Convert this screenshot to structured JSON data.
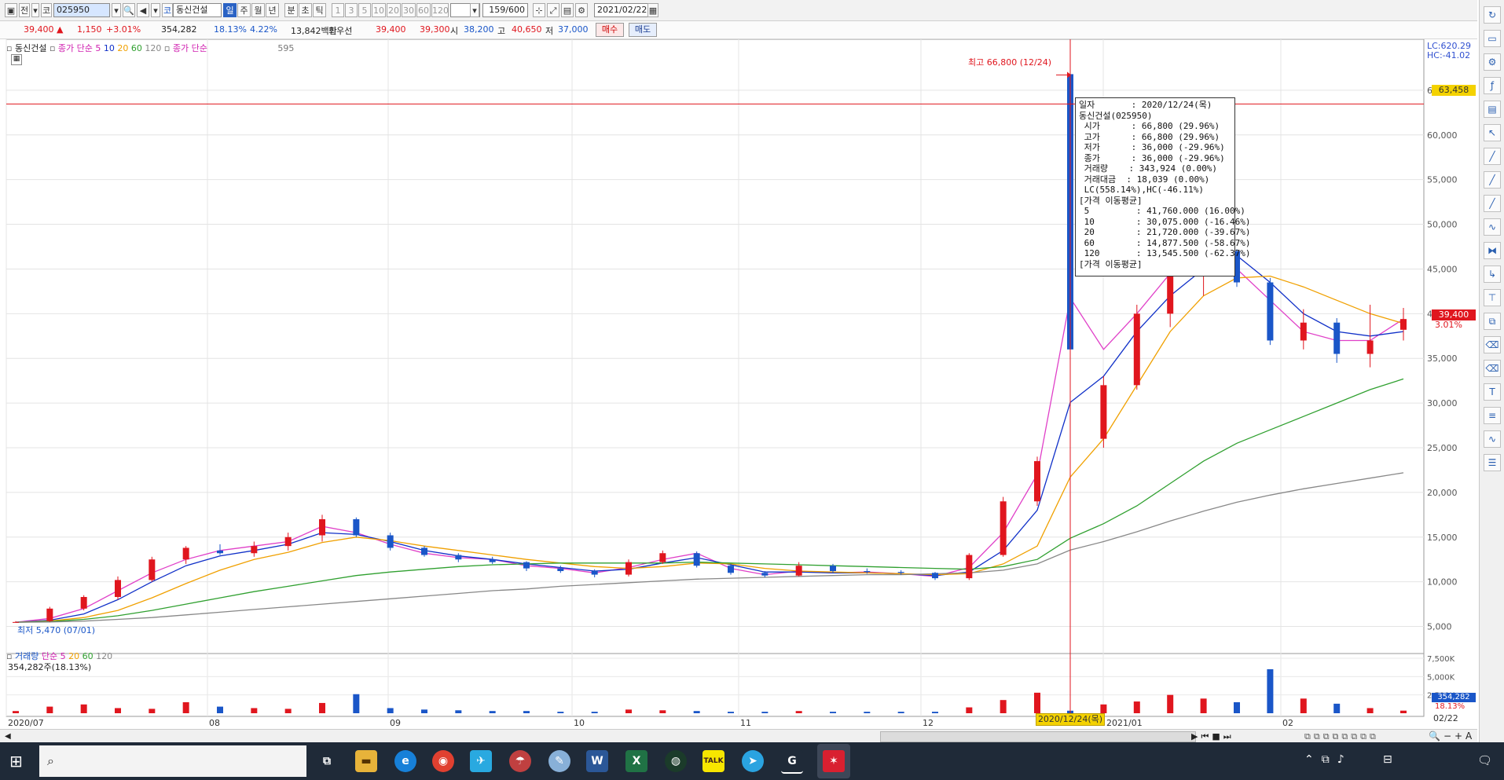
{
  "toolbar": {
    "code_value": "025950",
    "stock_name": "동신건설",
    "market_selector": "전",
    "period_buttons": [
      "일",
      "주",
      "월",
      "년",
      "분",
      "초",
      "틱"
    ],
    "interval_buttons": [
      "1",
      "3",
      "5",
      "10",
      "20",
      "30",
      "60",
      "120"
    ],
    "count_display": "159/600",
    "date_value": "2021/02/22",
    "market_type_label": "코"
  },
  "quote": {
    "price": "39,400",
    "change": "1,150",
    "change_pct": "+3.01%",
    "volume": "354,282",
    "vol_ratio": "18.13%",
    "turnover_ratio": "4.22%",
    "amount": "13,842백만",
    "best_label": "최우선",
    "best_ask": "39,400",
    "best_bid": "39,300",
    "open_label": "시",
    "open": "38,200",
    "high_label": "고",
    "high": "40,650",
    "low_label": "저",
    "low": "37,000",
    "buy_label": "매수",
    "sell_label": "매도"
  },
  "price_legend": {
    "name": "동신건설",
    "ma_label": "종가 단순",
    "ma_periods": [
      "5",
      "10",
      "20",
      "60",
      "120"
    ],
    "ma2_label": "종가 단순",
    "ma2_value": "595"
  },
  "volume_legend": {
    "title": "거래량",
    "ma_label": "단순",
    "ma_periods": [
      "5",
      "20",
      "60",
      "120"
    ],
    "current": "354,282주(18.13%)"
  },
  "annotations": {
    "high_marker": "최고 66,800 (12/24)",
    "low_marker": "최저 5,470 (07/01)",
    "lc": "LC:620.29",
    "hc": "HC:-41.02",
    "hline_value": "63,458",
    "cur_price_tag": "39,400",
    "cur_pct_tag": "3.01%",
    "vol_cur_tag": "354,282",
    "vol_pct_tag": "18.13%",
    "cursor_date": "2020/12/24(목)",
    "last_date_tag": "02/22"
  },
  "tooltip": [
    "일자       : 2020/12/24(목)",
    "동신건설(025950)",
    " 시가      : 66,800 (29.96%)",
    " 고가      : 66,800 (29.96%)",
    " 저가      : 36,000 (-29.96%)",
    " 종가      : 36,000 (-29.96%)",
    " 거래량    : 343,924 (0.00%)",
    " 거래대금  : 18,039 (0.00%)",
    " LC(558.14%),HC(-46.11%)",
    "[가격 이동평균]",
    " 5         : 41,760.000 (16.00%)",
    " 10        : 30,075.000 (-16.46%)",
    " 20        : 21,720.000 (-39.67%)",
    " 60        : 14,877.500 (-58.67%)",
    " 120       : 13,545.500 (-62.37%)",
    "[가격 이동평균]"
  ],
  "y_axis": [
    "65,000",
    "60,000",
    "55,000",
    "50,000",
    "45,000",
    "40,000",
    "35,000",
    "30,000",
    "25,000",
    "20,000",
    "15,000",
    "10,000",
    "5,000"
  ],
  "vol_axis": [
    "7,500K",
    "5,000K",
    "2,500K"
  ],
  "x_axis": [
    "2020/07",
    "08",
    "09",
    "10",
    "11",
    "12",
    "2021/01",
    "02",
    "02/22"
  ],
  "chart_data": {
    "type": "candlestick",
    "price_range": [
      5000,
      66800
    ],
    "series": [
      {
        "name": "5",
        "color": "#e040c8",
        "values": [
          5470,
          5900,
          7000,
          9000,
          11000,
          12500,
          13500,
          14000,
          14500,
          16200,
          15500,
          14200,
          13200,
          12700,
          12500,
          11800,
          11500,
          11000,
          11600,
          12500,
          13200,
          11500,
          10800,
          11200,
          11000,
          11100,
          10900,
          10600,
          11600,
          15500,
          22000,
          41760,
          36000,
          40000,
          44500,
          48000,
          45000,
          41500,
          38000,
          37000,
          37000,
          39400
        ]
      },
      {
        "name": "10",
        "color": "#1030c8",
        "values": [
          5470,
          5700,
          6400,
          8000,
          10000,
          11800,
          12900,
          13500,
          14200,
          15500,
          15300,
          14500,
          13500,
          12900,
          12500,
          12000,
          11600,
          11200,
          11400,
          12100,
          12700,
          11900,
          11100,
          11100,
          11000,
          11000,
          10900,
          10700,
          11100,
          13500,
          18000,
          30075,
          33000,
          38000,
          42000,
          45000,
          46500,
          43500,
          40000,
          38000,
          37500,
          38000
        ]
      },
      {
        "name": "20",
        "color": "#f0a000",
        "values": [
          5470,
          5600,
          6000,
          6800,
          8200,
          9800,
          11300,
          12500,
          13300,
          14400,
          15000,
          14600,
          14000,
          13500,
          13000,
          12500,
          12100,
          11700,
          11500,
          11700,
          12100,
          12000,
          11500,
          11200,
          11100,
          11000,
          10900,
          10800,
          10900,
          12000,
          14000,
          21720,
          26000,
          32000,
          38000,
          42000,
          44000,
          44200,
          43000,
          41500,
          40000,
          38900
        ]
      },
      {
        "name": "60",
        "color": "#30a030",
        "values": [
          5470,
          5550,
          5800,
          6200,
          6800,
          7500,
          8200,
          8900,
          9500,
          10100,
          10700,
          11100,
          11400,
          11700,
          11900,
          12000,
          12100,
          12100,
          12100,
          12100,
          12200,
          12100,
          12000,
          11900,
          11800,
          11700,
          11600,
          11500,
          11400,
          11700,
          12500,
          14877,
          16500,
          18500,
          21000,
          23500,
          25500,
          27000,
          28500,
          30000,
          31500,
          32700
        ]
      },
      {
        "name": "120",
        "color": "#888888",
        "values": [
          5470,
          5500,
          5600,
          5800,
          6000,
          6300,
          6600,
          6900,
          7200,
          7500,
          7800,
          8100,
          8400,
          8700,
          9000,
          9200,
          9500,
          9700,
          9900,
          10100,
          10300,
          10400,
          10500,
          10600,
          10700,
          10800,
          10800,
          10900,
          11000,
          11300,
          12000,
          13545,
          14500,
          15600,
          16800,
          17900,
          18900,
          19700,
          20400,
          21000,
          21600,
          22200
        ]
      }
    ],
    "candles": [
      {
        "o": 5470,
        "h": 5600,
        "l": 5470,
        "c": 5500
      },
      {
        "o": 5600,
        "h": 7200,
        "l": 5500,
        "c": 7000
      },
      {
        "o": 7000,
        "h": 8500,
        "l": 6800,
        "c": 8300
      },
      {
        "o": 8300,
        "h": 10600,
        "l": 8000,
        "c": 10200
      },
      {
        "o": 10200,
        "h": 12800,
        "l": 10000,
        "c": 12500
      },
      {
        "o": 12500,
        "h": 14000,
        "l": 12000,
        "c": 13800
      },
      {
        "o": 13500,
        "h": 14200,
        "l": 13000,
        "c": 13200
      },
      {
        "o": 13200,
        "h": 14500,
        "l": 12800,
        "c": 14000
      },
      {
        "o": 14000,
        "h": 15500,
        "l": 13500,
        "c": 15000
      },
      {
        "o": 15200,
        "h": 17500,
        "l": 14500,
        "c": 17000
      },
      {
        "o": 17000,
        "h": 17200,
        "l": 15000,
        "c": 15200
      },
      {
        "o": 15200,
        "h": 15500,
        "l": 13500,
        "c": 13800
      },
      {
        "o": 13800,
        "h": 14000,
        "l": 12800,
        "c": 13000
      },
      {
        "o": 13000,
        "h": 13200,
        "l": 12200,
        "c": 12500
      },
      {
        "o": 12500,
        "h": 12800,
        "l": 12000,
        "c": 12200
      },
      {
        "o": 12200,
        "h": 12300,
        "l": 11200,
        "c": 11500
      },
      {
        "o": 11500,
        "h": 11800,
        "l": 11000,
        "c": 11200
      },
      {
        "o": 11200,
        "h": 11400,
        "l": 10500,
        "c": 10800
      },
      {
        "o": 10800,
        "h": 12500,
        "l": 10600,
        "c": 12200
      },
      {
        "o": 12200,
        "h": 13500,
        "l": 12000,
        "c": 13200
      },
      {
        "o": 13200,
        "h": 13400,
        "l": 11600,
        "c": 11800
      },
      {
        "o": 11800,
        "h": 12000,
        "l": 10800,
        "c": 11000
      },
      {
        "o": 11000,
        "h": 11200,
        "l": 10500,
        "c": 10700
      },
      {
        "o": 10700,
        "h": 12200,
        "l": 10600,
        "c": 11800
      },
      {
        "o": 11800,
        "h": 12000,
        "l": 11000,
        "c": 11200
      },
      {
        "o": 11200,
        "h": 11500,
        "l": 10900,
        "c": 11100
      },
      {
        "o": 11100,
        "h": 11300,
        "l": 10800,
        "c": 11000
      },
      {
        "o": 11000,
        "h": 11100,
        "l": 10200,
        "c": 10400
      },
      {
        "o": 10400,
        "h": 13200,
        "l": 10200,
        "c": 13000
      },
      {
        "o": 13000,
        "h": 19500,
        "l": 12800,
        "c": 19000
      },
      {
        "o": 19000,
        "h": 24000,
        "l": 18500,
        "c": 23500
      },
      {
        "o": 66800,
        "h": 66800,
        "l": 36000,
        "c": 36000
      },
      {
        "o": 26000,
        "h": 33000,
        "l": 25000,
        "c": 32000
      },
      {
        "o": 32000,
        "h": 41000,
        "l": 31500,
        "c": 40000
      },
      {
        "o": 40000,
        "h": 46000,
        "l": 38500,
        "c": 44500
      },
      {
        "o": 44500,
        "h": 48000,
        "l": 42000,
        "c": 47000
      },
      {
        "o": 47000,
        "h": 47200,
        "l": 43000,
        "c": 43500
      },
      {
        "o": 43500,
        "h": 44000,
        "l": 36500,
        "c": 37000
      },
      {
        "o": 37000,
        "h": 40500,
        "l": 36000,
        "c": 39000
      },
      {
        "o": 39000,
        "h": 39500,
        "l": 34500,
        "c": 35500
      },
      {
        "o": 35500,
        "h": 41000,
        "l": 34000,
        "c": 37000
      },
      {
        "o": 38200,
        "h": 40650,
        "l": 37000,
        "c": 39400
      }
    ],
    "volume": [
      300,
      900,
      1200,
      700,
      600,
      1500,
      900,
      700,
      600,
      1400,
      2600,
      700,
      500,
      400,
      300,
      300,
      200,
      200,
      500,
      400,
      300,
      200,
      200,
      300,
      200,
      200,
      200,
      200,
      800,
      1800,
      2800,
      344,
      1200,
      1600,
      2500,
      2000,
      1500,
      6000,
      2000,
      1300,
      700,
      354
    ],
    "volume_unit": "K"
  }
}
